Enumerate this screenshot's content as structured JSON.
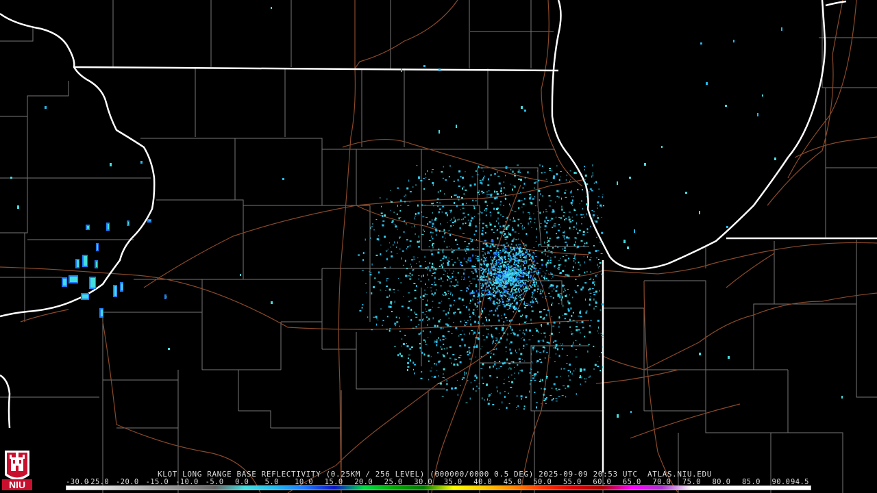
{
  "product_caption": "KLOT LONG RANGE BASE REFLECTIVITY (0.25KM / 256 LEVEL) (000000/0000 0.5 DEG) 2025-09-09 20:53 UTC  ATLAS.NIU.EDU",
  "scale": {
    "labels": [
      "-30.0",
      "-25.0",
      "-20.0",
      "-15.0",
      "-10.0",
      "-5.0",
      "0.0",
      "5.0",
      "10.0",
      "15.0",
      "20.0",
      "25.0",
      "30.0",
      "35.0",
      "40.0",
      "45.0",
      "50.0",
      "55.0",
      "60.0",
      "65.0",
      "70.0",
      "75.0",
      "80.0",
      "85.0",
      "90.0",
      "94.5"
    ],
    "colors": [
      "#ffffff",
      "#e8e8e8",
      "#c8c8c8",
      "#a8a8a8",
      "#888888",
      "#666666",
      "#44dddd",
      "#22bbee",
      "#1e78ff",
      "#0a14c8",
      "#00dd44",
      "#00aa00",
      "#007a00",
      "#ffff00",
      "#ffcc00",
      "#ff8800",
      "#ff3300",
      "#dd0000",
      "#aa0000",
      "#ff00ff",
      "#aa33cc",
      "#ffffff",
      "#ffffff",
      "#ffffff",
      "#ffffff",
      "#ffffff"
    ]
  },
  "logo": {
    "text": "NIU",
    "color": "#c8102e"
  },
  "radar_site": "KLOT"
}
